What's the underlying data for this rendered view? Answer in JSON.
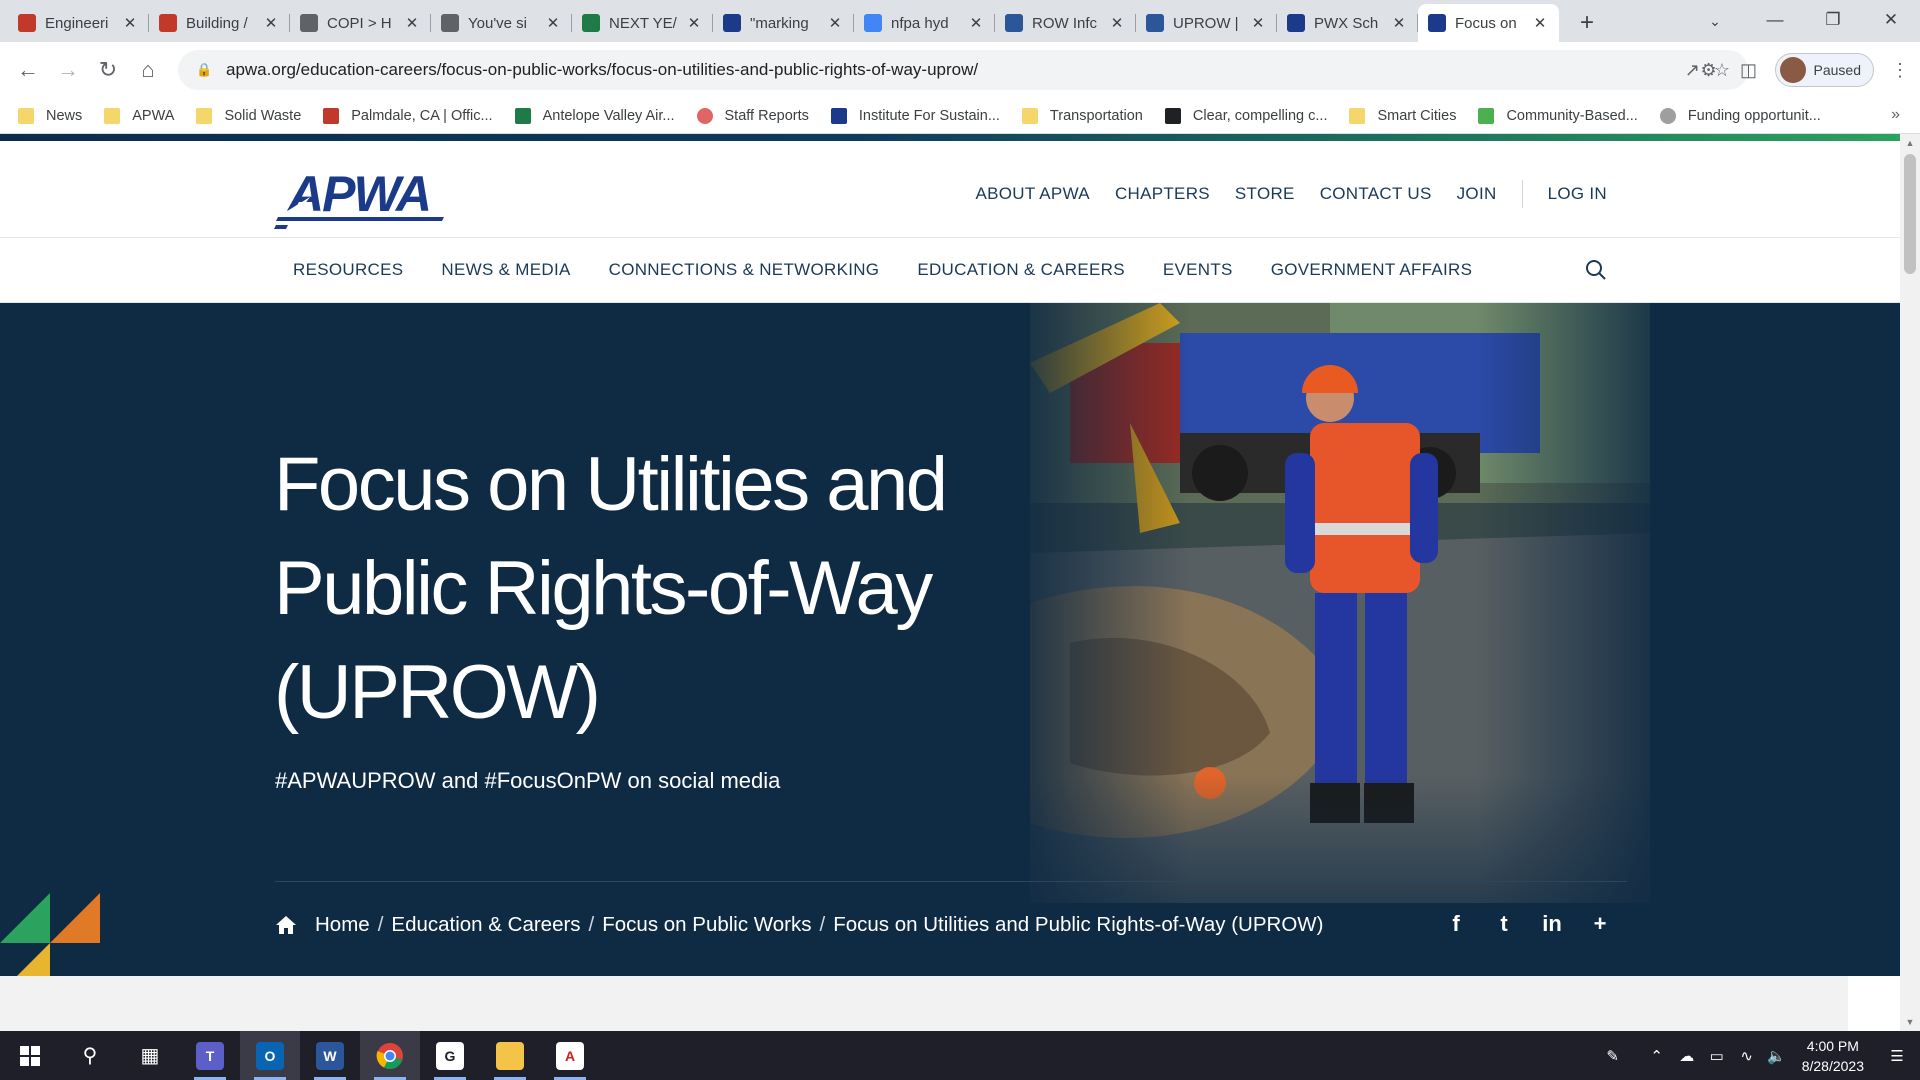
{
  "browser": {
    "tabs": [
      {
        "title": "Engineeri",
        "icon": "cp-icon",
        "color": "#c0392b"
      },
      {
        "title": "Building /",
        "icon": "cp-icon",
        "color": "#c0392b"
      },
      {
        "title": "COPI > H",
        "icon": "globe-icon",
        "color": "#5f6368"
      },
      {
        "title": "You've si",
        "icon": "globe-icon",
        "color": "#5f6368"
      },
      {
        "title": "NEXT YE/",
        "icon": "excel-icon",
        "color": "#1e7a46"
      },
      {
        "title": "\"marking",
        "icon": "apwa-icon",
        "color": "#1b3a8a"
      },
      {
        "title": "nfpa hyd",
        "icon": "google-icon",
        "color": "#4285f4"
      },
      {
        "title": "ROW Infc",
        "icon": "word-icon",
        "color": "#2b579a"
      },
      {
        "title": "UPROW |",
        "icon": "word-icon",
        "color": "#2b579a"
      },
      {
        "title": "PWX Sch",
        "icon": "apwa-icon",
        "color": "#1b3a8a"
      },
      {
        "title": "Focus on",
        "icon": "apwa-icon",
        "color": "#1b3a8a",
        "active": true
      }
    ],
    "url": "apwa.org/education-careers/focus-on-public-works/focus-on-utilities-and-public-rights-of-way-uprow/",
    "profile_label": "Paused",
    "bookmarks": [
      {
        "label": "News",
        "type": "folder"
      },
      {
        "label": "APWA",
        "type": "folder"
      },
      {
        "label": "Solid Waste",
        "type": "folder"
      },
      {
        "label": "Palmdale, CA | Offic...",
        "type": "cp"
      },
      {
        "label": "Antelope Valley Air...",
        "type": "site"
      },
      {
        "label": "Staff Reports",
        "type": "g"
      },
      {
        "label": "Institute For Sustain...",
        "type": "apwa"
      },
      {
        "label": "Transportation",
        "type": "folder"
      },
      {
        "label": "Clear, compelling c...",
        "type": "dark"
      },
      {
        "label": "Smart Cities",
        "type": "folder"
      },
      {
        "label": "Community-Based...",
        "type": "green"
      },
      {
        "label": "Funding opportunit...",
        "type": "circle"
      }
    ]
  },
  "site": {
    "logo_text": "APWA",
    "utility_nav": [
      "ABOUT APWA",
      "CHAPTERS",
      "STORE",
      "CONTACT US",
      "JOIN"
    ],
    "login_label": "LOG IN",
    "main_nav": [
      "RESOURCES",
      "NEWS & MEDIA",
      "CONNECTIONS & NETWORKING",
      "EDUCATION & CAREERS",
      "EVENTS",
      "GOVERNMENT AFFAIRS"
    ],
    "hero": {
      "title_lines": [
        "Focus on Utilities and",
        "Public Rights-of-Way",
        "(UPROW)"
      ],
      "hashtags": "#APWAUPROW and #FocusOnPW on social media"
    },
    "breadcrumb": [
      "Home",
      "Education & Careers",
      "Focus on Public Works",
      "Focus on Utilities and Public Rights-of-Way (UPROW)"
    ],
    "social": [
      "f",
      "t",
      "in",
      "+"
    ]
  },
  "taskbar": {
    "time": "4:00 PM",
    "date": "8/28/2023"
  },
  "colors": {
    "navy": "#0f2a43",
    "brand_blue": "#1b3a8a",
    "accent_green": "#2ba25e"
  }
}
